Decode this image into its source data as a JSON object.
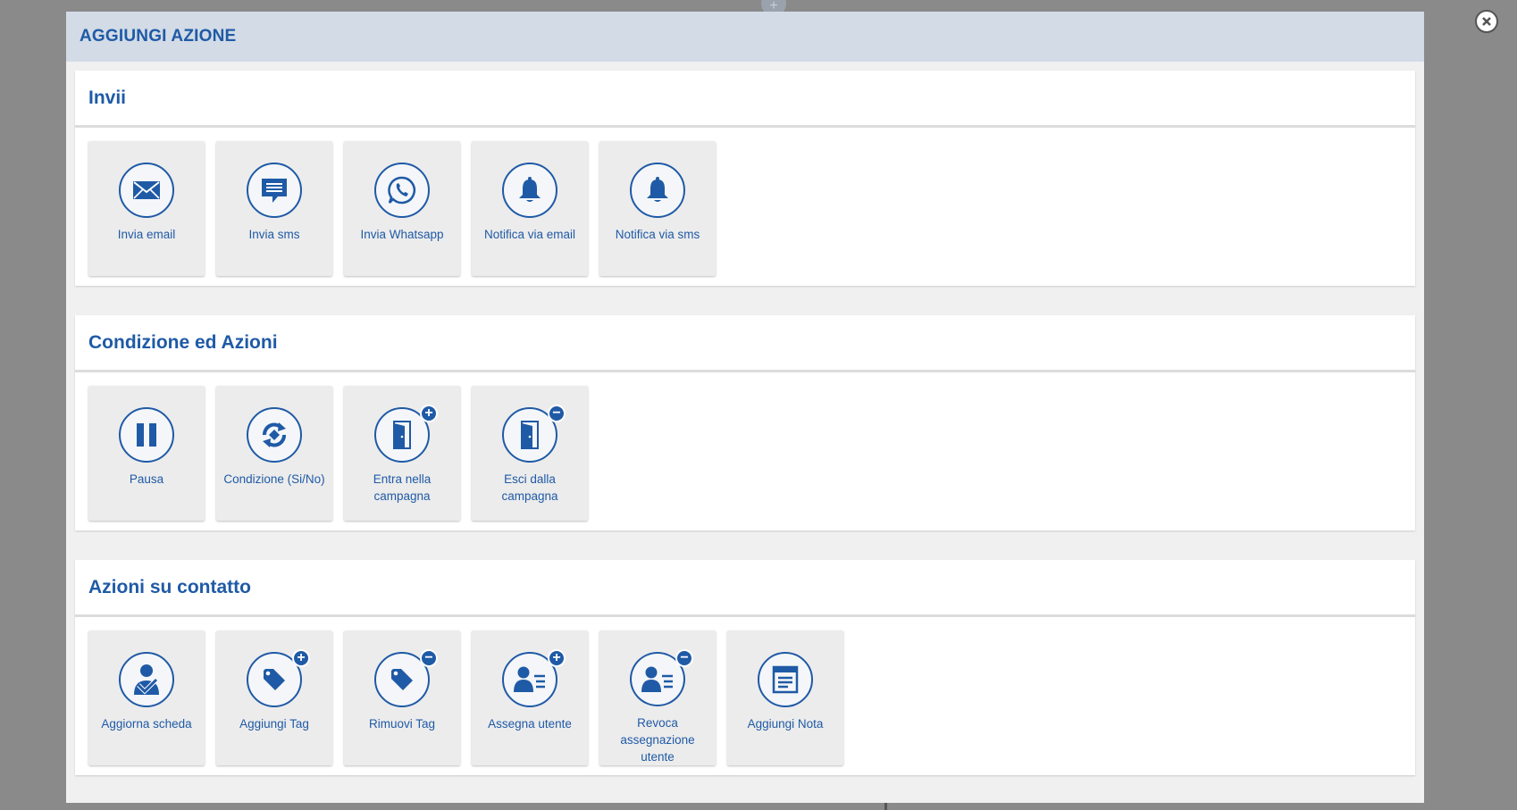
{
  "modal": {
    "title": "AGGIUNGI AZIONE"
  },
  "sections": [
    {
      "title": "Invii",
      "items": [
        {
          "label": "Invia email",
          "icon": "envelope-icon"
        },
        {
          "label": "Invia sms",
          "icon": "chat-message-icon"
        },
        {
          "label": "Invia Whatsapp",
          "icon": "whatsapp-icon"
        },
        {
          "label": "Notifica via email",
          "icon": "bell-icon"
        },
        {
          "label": "Notifica via sms",
          "icon": "bell-icon"
        }
      ]
    },
    {
      "title": "Condizione ed Azioni",
      "items": [
        {
          "label": "Pausa",
          "icon": "pause-icon"
        },
        {
          "label": "Condizione (Si/No)",
          "icon": "refresh-condition-icon"
        },
        {
          "label": "Entra nella campagna",
          "icon": "door-enter-icon",
          "badge": "+"
        },
        {
          "label": "Esci dalla campagna",
          "icon": "door-exit-icon",
          "badge": "−"
        }
      ]
    },
    {
      "title": "Azioni su contatto",
      "items": [
        {
          "label": "Aggiorna scheda",
          "icon": "user-check-icon"
        },
        {
          "label": "Aggiungi Tag",
          "icon": "tag-icon",
          "badge": "+"
        },
        {
          "label": "Rimuovi Tag",
          "icon": "tag-icon",
          "badge": "−"
        },
        {
          "label": "Assegna utente",
          "icon": "user-card-icon",
          "badge": "+"
        },
        {
          "label": "Revoca assegnazione utente",
          "icon": "user-card-icon",
          "badge": "−"
        },
        {
          "label": "Aggiungi Nota",
          "icon": "note-icon"
        }
      ]
    }
  ],
  "colors": {
    "accent": "#1f5aa6",
    "header_bg": "#d2dbe6",
    "card_bg": "#ececec",
    "overlay": "#8a8a8a"
  }
}
